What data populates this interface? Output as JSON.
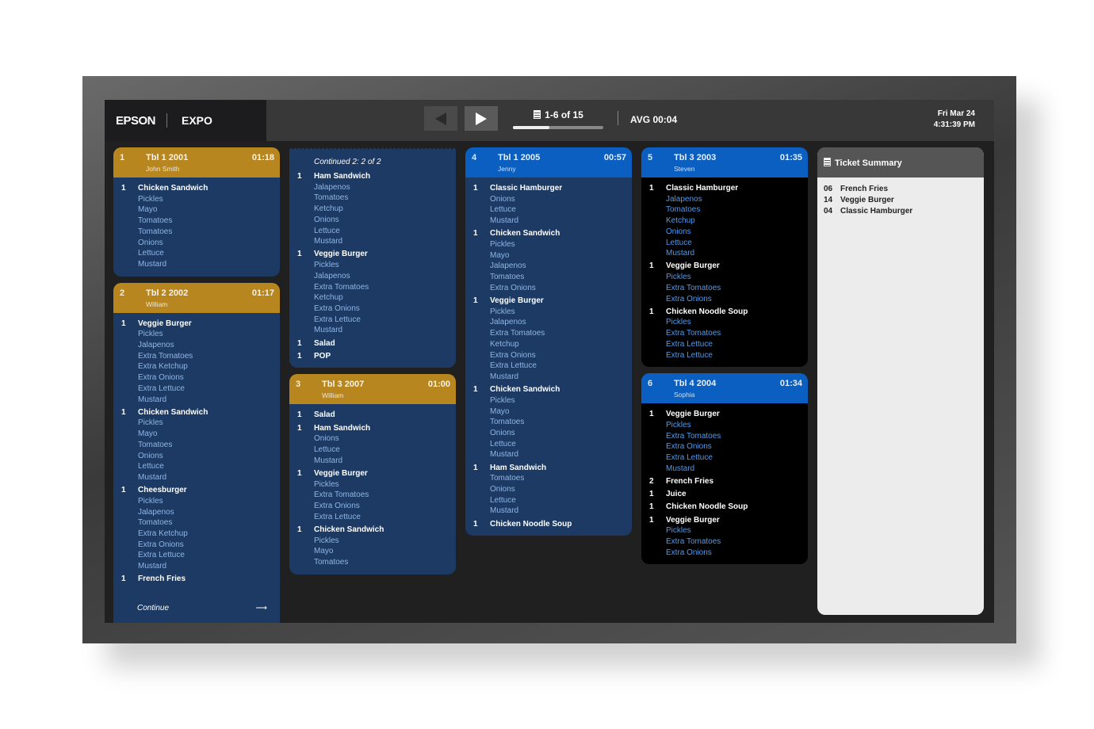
{
  "header": {
    "brand": "EPSON",
    "app": "EXPO",
    "pager": "1-6 of 15",
    "progress_percent": 40,
    "avg": "AVG 00:04",
    "date": "Fri Mar 24",
    "time": "4:31:39 PM"
  },
  "colors": {
    "gold": "#b8861e",
    "blue": "#0a5fc0",
    "navy": "#1c3a63"
  },
  "columns": [
    [
      {
        "num": "1",
        "table": "Tbl 1 2001",
        "server": "John Smith",
        "time": "01:18",
        "header": "gold",
        "body": "navy",
        "items": [
          {
            "q": "1",
            "name": "Chicken Sandwich",
            "mods": [
              "Pickles",
              "Mayo",
              "Tomatoes",
              "Tomatoes",
              "Onions",
              "Lettuce",
              "Mustard"
            ]
          }
        ]
      },
      {
        "num": "2",
        "table": "Tbl 2 2002",
        "server": "William",
        "time": "01:17",
        "header": "gold",
        "body": "navy",
        "continue_label": "Continue",
        "items": [
          {
            "q": "1",
            "name": "Veggie Burger",
            "mods": [
              "Pickles",
              "Jalapenos",
              "Extra Tomatoes",
              "Extra Ketchup",
              "Extra Onions",
              "Extra Lettuce",
              "Mustard"
            ]
          },
          {
            "q": "1",
            "name": "Chicken Sandwich",
            "mods": [
              "Pickles",
              "Mayo",
              "Tomatoes",
              "Onions",
              "Lettuce",
              "Mustard"
            ]
          },
          {
            "q": "1",
            "name": "Cheesburger",
            "mods": [
              "Pickles",
              "Jalapenos",
              "Tomatoes",
              "Extra Ketchup",
              "Extra Onions",
              "Extra Lettuce",
              "Mustard"
            ]
          },
          {
            "q": "1",
            "name": "French Fries",
            "mods": []
          }
        ]
      }
    ],
    [
      {
        "continued": "Continued 2: 2 of 2",
        "body": "navy",
        "items": [
          {
            "q": "1",
            "name": "Ham Sandwich",
            "mods": [
              "Jalapenos",
              "Tomatoes",
              "Ketchup",
              "Onions",
              "Lettuce",
              "Mustard"
            ]
          },
          {
            "q": "1",
            "name": "Veggie Burger",
            "mods": [
              "Pickles",
              "Jalapenos",
              "Extra Tomatoes",
              "Ketchup",
              "Extra Onions",
              "Extra Lettuce",
              "Mustard"
            ]
          },
          {
            "q": "1",
            "name": "Salad",
            "mods": []
          },
          {
            "q": "1",
            "name": "POP",
            "mods": []
          }
        ]
      },
      {
        "num": "3",
        "table": "Tbl 3 2007",
        "server": "William",
        "time": "01:00",
        "header": "gold",
        "body": "navy",
        "items": [
          {
            "q": "1",
            "name": "Salad",
            "mods": []
          },
          {
            "q": "1",
            "name": "Ham Sandwich",
            "mods": [
              "Onions",
              "Lettuce",
              "Mustard"
            ]
          },
          {
            "q": "1",
            "name": "Veggie Burger",
            "mods": [
              "Pickles",
              "Extra Tomatoes",
              "Extra Onions",
              "Extra Lettuce"
            ]
          },
          {
            "q": "1",
            "name": "Chicken Sandwich",
            "mods": [
              "Pickles",
              "Mayo",
              "Tomatoes"
            ]
          }
        ]
      }
    ],
    [
      {
        "num": "4",
        "table": "Tbl 1 2005",
        "server": "Jenny",
        "time": "00:57",
        "header": "blue",
        "body": "navy",
        "items": [
          {
            "q": "1",
            "name": "Classic Hamburger",
            "mods": [
              "Onions",
              "Lettuce",
              "Mustard"
            ]
          },
          {
            "q": "1",
            "name": "Chicken Sandwich",
            "mods": [
              "Pickles",
              "Mayo",
              "Jalapenos",
              "Tomatoes",
              "Extra Onions"
            ]
          },
          {
            "q": "1",
            "name": "Veggie Burger",
            "mods": [
              "Pickles",
              "Jalapenos",
              "Extra Tomatoes",
              "Ketchup",
              "Extra Onions",
              "Extra Lettuce",
              "Mustard"
            ]
          },
          {
            "q": "1",
            "name": "Chicken Sandwich",
            "mods": [
              "Pickles",
              "Mayo",
              "Tomatoes",
              "Onions",
              "Lettuce",
              "Mustard"
            ]
          },
          {
            "q": "1",
            "name": "Ham Sandwich",
            "mods": [
              "Tomatoes",
              "Onions",
              "Lettuce",
              "Mustard"
            ]
          },
          {
            "q": "1",
            "name": "Chicken Noodle Soup",
            "mods": []
          }
        ]
      }
    ],
    [
      {
        "num": "5",
        "table": "Tbl 3 2003",
        "server": "Steven",
        "time": "01:35",
        "header": "blue",
        "body": "black",
        "items": [
          {
            "q": "1",
            "name": "Classic Hamburger",
            "mods": [
              "Jalapenos",
              "Tomatoes",
              "Ketchup",
              "Onions",
              "Lettuce",
              "Mustard"
            ]
          },
          {
            "q": "1",
            "name": "Veggie Burger",
            "mods": [
              "Pickles",
              "Extra Tomatoes",
              "Extra Onions"
            ]
          },
          {
            "q": "1",
            "name": "Chicken Noodle Soup",
            "mods": [
              "Pickles",
              "Extra Tomatoes",
              "Extra Lettuce",
              "Extra Lettuce"
            ]
          }
        ]
      },
      {
        "num": "6",
        "table": "Tbl 4 2004",
        "server": "Sophia",
        "time": "01:34",
        "header": "blue",
        "body": "black",
        "items": [
          {
            "q": "1",
            "name": "Veggie Burger",
            "mods": [
              "Pickles",
              "Extra Tomatoes",
              "Extra Onions",
              "Extra Lettuce",
              "Mustard"
            ]
          },
          {
            "q": "2",
            "name": "French Fries",
            "mods": []
          },
          {
            "q": "1",
            "name": "Juice",
            "mods": []
          },
          {
            "q": "1",
            "name": "Chicken Noodle Soup",
            "mods": []
          },
          {
            "q": "1",
            "name": "Veggie Burger",
            "mods": [
              "Pickles",
              "Extra Tomatoes",
              "Extra Onions"
            ]
          }
        ]
      }
    ]
  ],
  "summary": {
    "title": "Ticket Summary",
    "rows": [
      {
        "count": "06",
        "name": "French Fries"
      },
      {
        "count": "14",
        "name": "Veggie Burger"
      },
      {
        "count": "04",
        "name": "Classic Hamburger"
      }
    ]
  }
}
